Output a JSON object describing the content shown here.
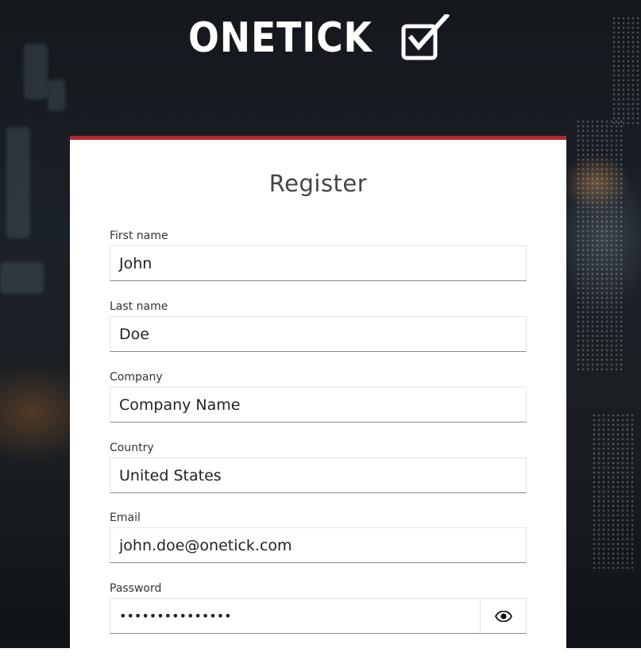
{
  "brand": {
    "logo_text": "ONETICK",
    "logo_icon": "checkbox-tick-icon"
  },
  "colors": {
    "accent": "#b1282e",
    "card_background": "#ffffff",
    "text": "#222222"
  },
  "form": {
    "title": "Register",
    "fields": [
      {
        "label": "First name",
        "value": "John"
      },
      {
        "label": "Last name",
        "value": "Doe"
      },
      {
        "label": "Company",
        "value": "Company Name"
      },
      {
        "label": "Country",
        "value": "United States"
      },
      {
        "label": "Email",
        "value": "john.doe@onetick.com"
      },
      {
        "label": "Password",
        "value": "•••••••••••••••",
        "toggle_icon": "eye-icon"
      }
    ]
  }
}
